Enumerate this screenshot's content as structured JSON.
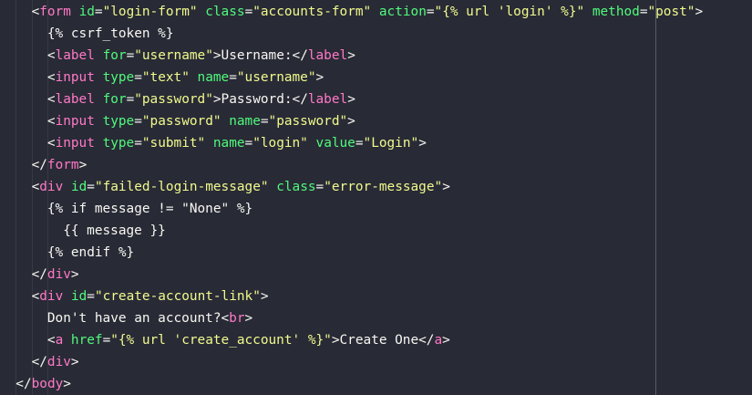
{
  "editor": {
    "colors": {
      "background": "#282a36",
      "tag": "#ff79c6",
      "attribute": "#50fa7b",
      "string": "#f1fa8c",
      "text": "#f8f8f2",
      "ruler": "#5a5c68"
    },
    "lines": [
      {
        "indent": 4,
        "tokens": [
          [
            "p",
            "<"
          ],
          [
            "tag",
            "form"
          ],
          [
            "p",
            " "
          ],
          [
            "attr",
            "id"
          ],
          [
            "p",
            "="
          ],
          [
            "str",
            "\"login-form\""
          ],
          [
            "p",
            " "
          ],
          [
            "attr",
            "class"
          ],
          [
            "p",
            "="
          ],
          [
            "str",
            "\"accounts-form\""
          ],
          [
            "p",
            " "
          ],
          [
            "attr",
            "action"
          ],
          [
            "p",
            "="
          ],
          [
            "str",
            "\"{% url 'login' %}\""
          ],
          [
            "p",
            " "
          ],
          [
            "attr",
            "method"
          ],
          [
            "p",
            "="
          ],
          [
            "str",
            "\"post\""
          ],
          [
            "p",
            ">"
          ]
        ]
      },
      {
        "indent": 6,
        "tokens": [
          [
            "t",
            "{% csrf_token %}"
          ]
        ]
      },
      {
        "indent": 6,
        "tokens": [
          [
            "p",
            "<"
          ],
          [
            "tag",
            "label"
          ],
          [
            "p",
            " "
          ],
          [
            "attr",
            "for"
          ],
          [
            "p",
            "="
          ],
          [
            "str",
            "\"username\""
          ],
          [
            "p",
            ">"
          ],
          [
            "t",
            "Username:"
          ],
          [
            "p",
            "</"
          ],
          [
            "tag",
            "label"
          ],
          [
            "p",
            ">"
          ]
        ]
      },
      {
        "indent": 6,
        "tokens": [
          [
            "p",
            "<"
          ],
          [
            "tag",
            "input"
          ],
          [
            "p",
            " "
          ],
          [
            "attr",
            "type"
          ],
          [
            "p",
            "="
          ],
          [
            "str",
            "\"text\""
          ],
          [
            "p",
            " "
          ],
          [
            "attr",
            "name"
          ],
          [
            "p",
            "="
          ],
          [
            "str",
            "\"username\""
          ],
          [
            "p",
            ">"
          ]
        ]
      },
      {
        "indent": 6,
        "tokens": [
          [
            "p",
            "<"
          ],
          [
            "tag",
            "label"
          ],
          [
            "p",
            " "
          ],
          [
            "attr",
            "for"
          ],
          [
            "p",
            "="
          ],
          [
            "str",
            "\"password\""
          ],
          [
            "p",
            ">"
          ],
          [
            "t",
            "Password:"
          ],
          [
            "p",
            "</"
          ],
          [
            "tag",
            "label"
          ],
          [
            "p",
            ">"
          ]
        ]
      },
      {
        "indent": 6,
        "tokens": [
          [
            "p",
            "<"
          ],
          [
            "tag",
            "input"
          ],
          [
            "p",
            " "
          ],
          [
            "attr",
            "type"
          ],
          [
            "p",
            "="
          ],
          [
            "str",
            "\"password\""
          ],
          [
            "p",
            " "
          ],
          [
            "attr",
            "name"
          ],
          [
            "p",
            "="
          ],
          [
            "str",
            "\"password\""
          ],
          [
            "p",
            ">"
          ]
        ]
      },
      {
        "indent": 6,
        "tokens": [
          [
            "p",
            "<"
          ],
          [
            "tag",
            "input"
          ],
          [
            "p",
            " "
          ],
          [
            "attr",
            "type"
          ],
          [
            "p",
            "="
          ],
          [
            "str",
            "\"submit\""
          ],
          [
            "p",
            " "
          ],
          [
            "attr",
            "name"
          ],
          [
            "p",
            "="
          ],
          [
            "str",
            "\"login\""
          ],
          [
            "p",
            " "
          ],
          [
            "attr",
            "value"
          ],
          [
            "p",
            "="
          ],
          [
            "str",
            "\"Login\""
          ],
          [
            "p",
            ">"
          ]
        ]
      },
      {
        "indent": 4,
        "tokens": [
          [
            "p",
            "</"
          ],
          [
            "tag",
            "form"
          ],
          [
            "p",
            ">"
          ]
        ]
      },
      {
        "indent": 4,
        "tokens": [
          [
            "p",
            "<"
          ],
          [
            "tag",
            "div"
          ],
          [
            "p",
            " "
          ],
          [
            "attr",
            "id"
          ],
          [
            "p",
            "="
          ],
          [
            "str",
            "\"failed-login-message\""
          ],
          [
            "p",
            " "
          ],
          [
            "attr",
            "class"
          ],
          [
            "p",
            "="
          ],
          [
            "str",
            "\"error-message\""
          ],
          [
            "p",
            ">"
          ]
        ]
      },
      {
        "indent": 6,
        "tokens": [
          [
            "t",
            "{% if message != \"None\" %}"
          ]
        ]
      },
      {
        "indent": 8,
        "tokens": [
          [
            "t",
            "{{ message }}"
          ]
        ]
      },
      {
        "indent": 6,
        "tokens": [
          [
            "t",
            "{% endif %}"
          ]
        ]
      },
      {
        "indent": 4,
        "tokens": [
          [
            "p",
            "</"
          ],
          [
            "tag",
            "div"
          ],
          [
            "p",
            ">"
          ]
        ]
      },
      {
        "indent": 4,
        "tokens": [
          [
            "p",
            "<"
          ],
          [
            "tag",
            "div"
          ],
          [
            "p",
            " "
          ],
          [
            "attr",
            "id"
          ],
          [
            "p",
            "="
          ],
          [
            "str",
            "\"create-account-link\""
          ],
          [
            "p",
            ">"
          ]
        ]
      },
      {
        "indent": 6,
        "tokens": [
          [
            "t",
            "Don't have an account?"
          ],
          [
            "p",
            "<"
          ],
          [
            "tag",
            "br"
          ],
          [
            "p",
            ">"
          ]
        ]
      },
      {
        "indent": 6,
        "tokens": [
          [
            "p",
            "<"
          ],
          [
            "tag",
            "a"
          ],
          [
            "p",
            " "
          ],
          [
            "attr",
            "href"
          ],
          [
            "p",
            "="
          ],
          [
            "str",
            "\"{% url 'create_account' %}\""
          ],
          [
            "p",
            ">"
          ],
          [
            "t",
            "Create One"
          ],
          [
            "p",
            "</"
          ],
          [
            "tag",
            "a"
          ],
          [
            "p",
            ">"
          ]
        ]
      },
      {
        "indent": 4,
        "tokens": [
          [
            "p",
            "</"
          ],
          [
            "tag",
            "div"
          ],
          [
            "p",
            ">"
          ]
        ]
      },
      {
        "indent": 2,
        "tokens": [
          [
            "p",
            "</"
          ],
          [
            "tag",
            "body"
          ],
          [
            "p",
            ">"
          ]
        ]
      }
    ]
  }
}
